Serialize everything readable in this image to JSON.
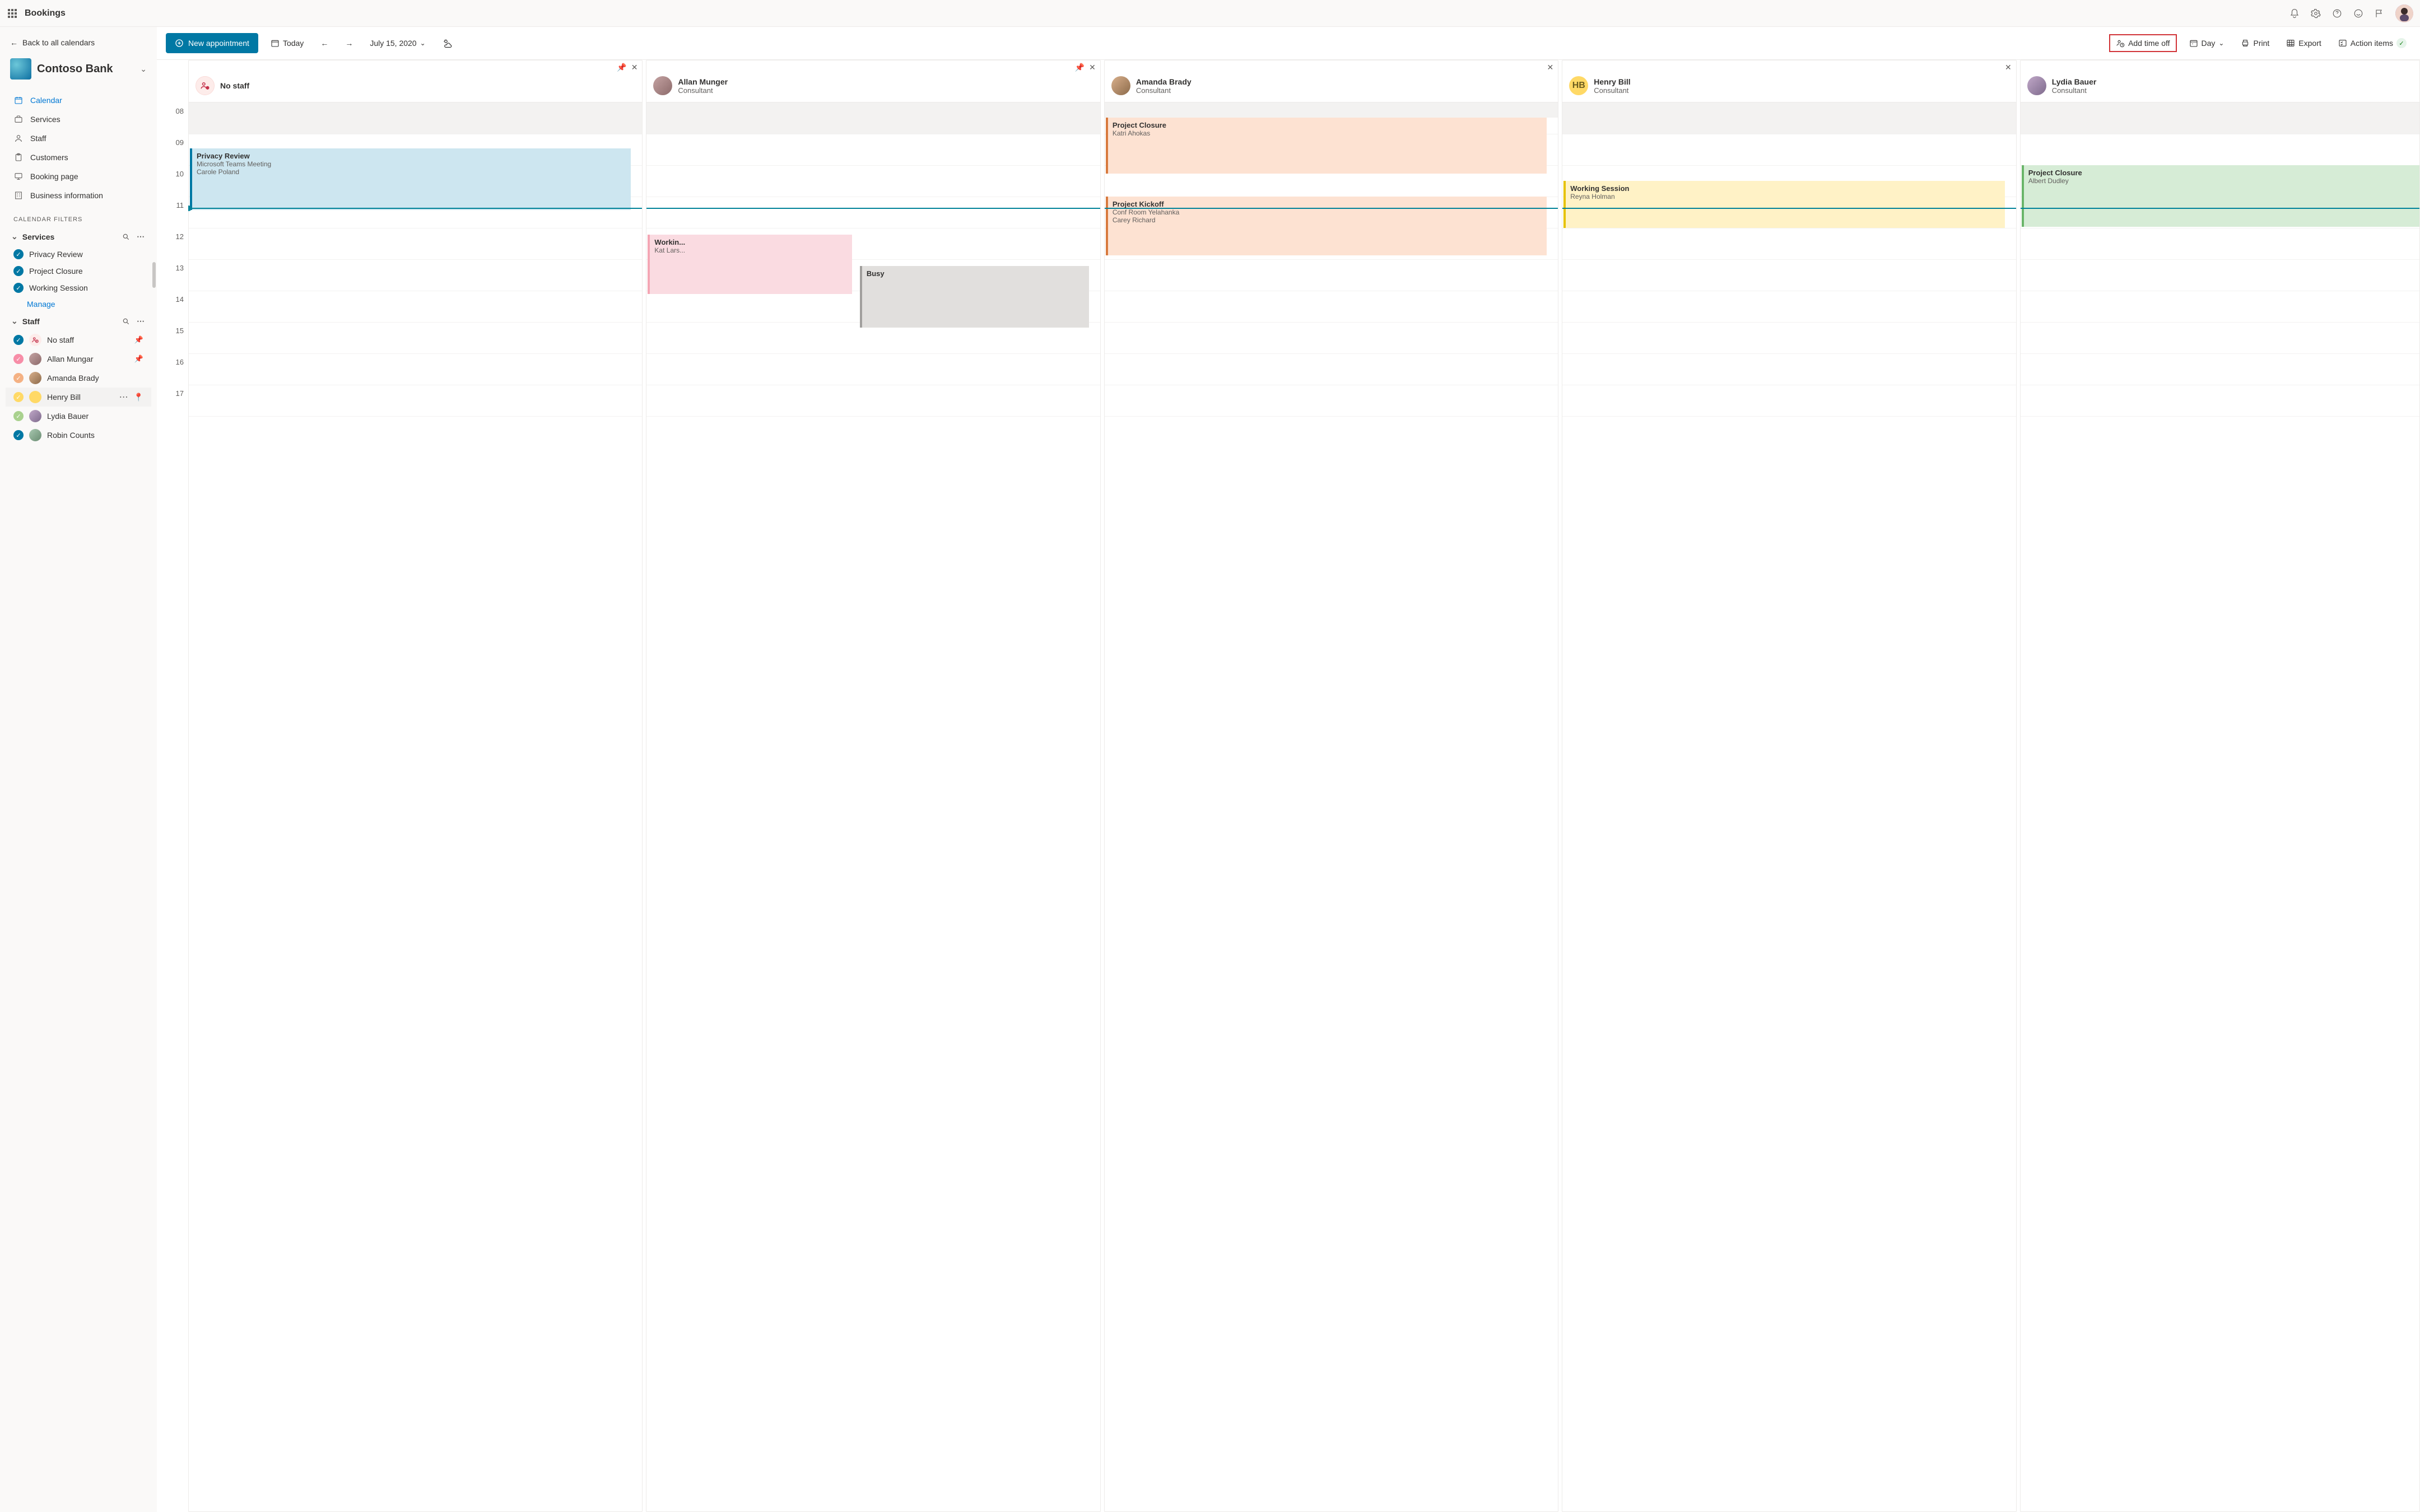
{
  "header": {
    "appName": "Bookings"
  },
  "sidebar": {
    "backLabel": "Back to all calendars",
    "businessName": "Contoso Bank",
    "nav": [
      {
        "label": "Calendar"
      },
      {
        "label": "Services"
      },
      {
        "label": "Staff"
      },
      {
        "label": "Customers"
      },
      {
        "label": "Booking page"
      },
      {
        "label": "Business information"
      }
    ],
    "filtersTitle": "CALENDAR FILTERS",
    "servicesHead": "Services",
    "services": [
      {
        "label": "Privacy Review"
      },
      {
        "label": "Project Closure"
      },
      {
        "label": "Working Session"
      }
    ],
    "manageLabel": "Manage",
    "staffHead": "Staff",
    "staff": [
      {
        "label": "No staff"
      },
      {
        "label": "Allan Mungar"
      },
      {
        "label": "Amanda Brady"
      },
      {
        "label": "Henry Bill"
      },
      {
        "label": "Lydia Bauer"
      },
      {
        "label": "Robin Counts"
      }
    ]
  },
  "toolbar": {
    "newAppointment": "New appointment",
    "today": "Today",
    "date": "July 15, 2020",
    "addTimeOff": "Add time off",
    "day": "Day",
    "print": "Print",
    "export": "Export",
    "actionItems": "Action items"
  },
  "columns": [
    {
      "name": "No staff",
      "role": ""
    },
    {
      "name": "Allan Munger",
      "role": "Consultant"
    },
    {
      "name": "Amanda Brady",
      "role": "Consultant"
    },
    {
      "name": "Henry Bill",
      "role": "Consultant",
      "initials": "HB"
    },
    {
      "name": "Lydia Bauer",
      "role": "Consultant"
    }
  ],
  "hours": [
    "08",
    "09",
    "10",
    "11",
    "12",
    "13",
    "14",
    "15",
    "16",
    "17"
  ],
  "events": {
    "privacy": {
      "title": "Privacy Review",
      "sub1": "Microsoft Teams Meeting",
      "sub2": "Carole Poland"
    },
    "workin": {
      "title": "Workin...",
      "sub1": "Kat Lars..."
    },
    "busy": {
      "title": "Busy"
    },
    "closure1": {
      "title": "Project Closure",
      "sub1": "Katri Ahokas"
    },
    "kickoff": {
      "title": "Project Kickoff",
      "sub1": "Conf Room Yelahanka",
      "sub2": "Carey Richard"
    },
    "working": {
      "title": "Working Session",
      "sub1": "Reyna Holman"
    },
    "closure2": {
      "title": "Project Closure",
      "sub1": "Albert Dudley"
    }
  }
}
